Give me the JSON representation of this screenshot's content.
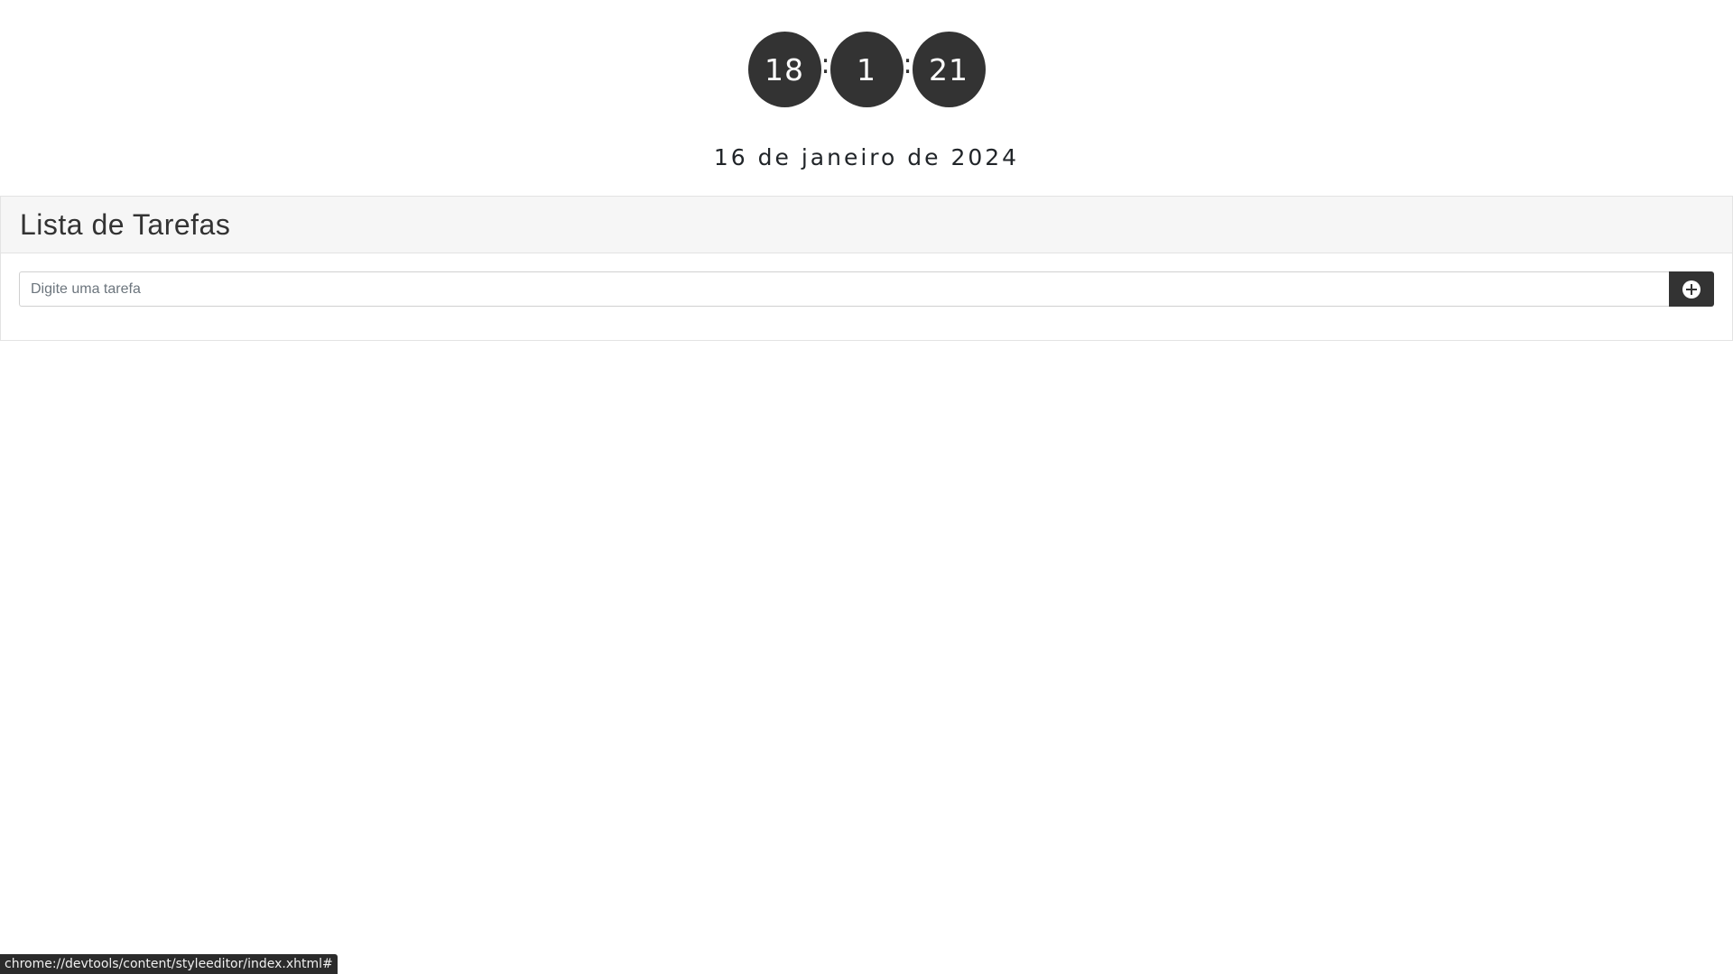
{
  "clock": {
    "hours": "18",
    "minutes": "1",
    "seconds": "21",
    "separator": ":"
  },
  "date": "16 de janeiro de 2024",
  "tasks": {
    "title": "Lista de Tarefas",
    "input_placeholder": "Digite uma tarefa",
    "input_value": "",
    "add_button_icon": "plus-circle-icon"
  },
  "status_bar": {
    "url": "chrome://devtools/content/styleeditor/index.xhtml#"
  },
  "colors": {
    "clock_bg": "#333333",
    "clock_text": "#ffffff",
    "header_bg": "#f6f6f6",
    "button_bg": "#333333"
  }
}
